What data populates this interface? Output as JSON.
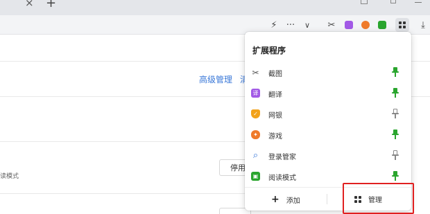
{
  "tabstrip": {
    "close_glyph": "×",
    "new_tab_glyph": "+"
  },
  "toolbar": {
    "icons": [
      "lightning-icon",
      "more-icon",
      "chevron-down-icon",
      "scissors-icon",
      "translate-icon",
      "game-icon",
      "reader-icon",
      "extensions-grid-icon",
      "download-icon"
    ],
    "more_glyph": "···",
    "chevron_glyph": "∨",
    "lightning_glyph": "⚡",
    "scissors_glyph": "✂",
    "download_glyph": "⤓",
    "translate_color": "#a259e6",
    "game_color": "#ef7a2a",
    "reader_color": "#2aa52e"
  },
  "page": {
    "advanced_link": "高级管理",
    "cut_link": "清",
    "row_text": "读模式",
    "disable_button": "停用"
  },
  "popup": {
    "title": "扩展程序",
    "items": [
      {
        "label": "截图",
        "icon": "scissors-icon",
        "glyph": "✂",
        "icon_color": "#555555",
        "pinned": true
      },
      {
        "label": "翻译",
        "icon": "translate-icon",
        "glyph": "译",
        "icon_color": "#a259e6",
        "pinned": true
      },
      {
        "label": "网银",
        "icon": "shield-icon",
        "glyph": "✓",
        "icon_color": "#f2a21a",
        "pinned": false
      },
      {
        "label": "游戏",
        "icon": "gamepad-icon",
        "glyph": "✦",
        "icon_color": "#ef7a2a",
        "pinned": true
      },
      {
        "label": "登录管家",
        "icon": "magnifier-icon",
        "glyph": "⌕",
        "icon_color": "#3a78d8",
        "pinned": false
      },
      {
        "label": "阅读模式",
        "icon": "reader-icon",
        "glyph": "▣",
        "icon_color": "#2aa52e",
        "pinned": true
      }
    ],
    "add_label": "添加",
    "add_glyph": "+",
    "manage_label": "管理"
  },
  "colors": {
    "link": "#3a78d8",
    "pin_on": "#2aa52e",
    "highlight": "#e02020"
  }
}
